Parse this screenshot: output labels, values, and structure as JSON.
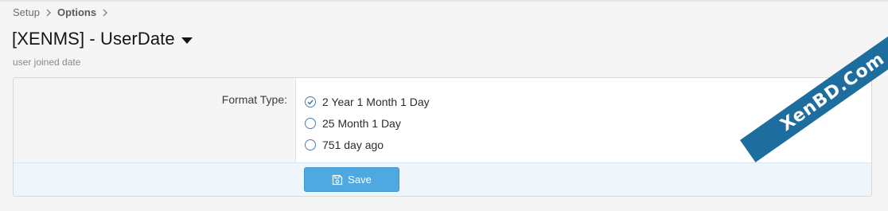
{
  "breadcrumb": {
    "items": [
      "Setup",
      "Options"
    ]
  },
  "header": {
    "title": "[XENMS] - UserDate",
    "description": "user joined date"
  },
  "form": {
    "field_label": "Format Type:",
    "options": [
      {
        "label": "2 Year 1 Month 1 Day",
        "selected": true
      },
      {
        "label": "25 Month 1 Day",
        "selected": false
      },
      {
        "label": "751 day ago",
        "selected": false
      }
    ],
    "save_label": "Save"
  },
  "watermark": {
    "text": "XenBD.Com"
  },
  "colors": {
    "accent": "#4fa8e0",
    "radio_border": "#4a7fae",
    "ribbon": "#1e6d9f"
  }
}
